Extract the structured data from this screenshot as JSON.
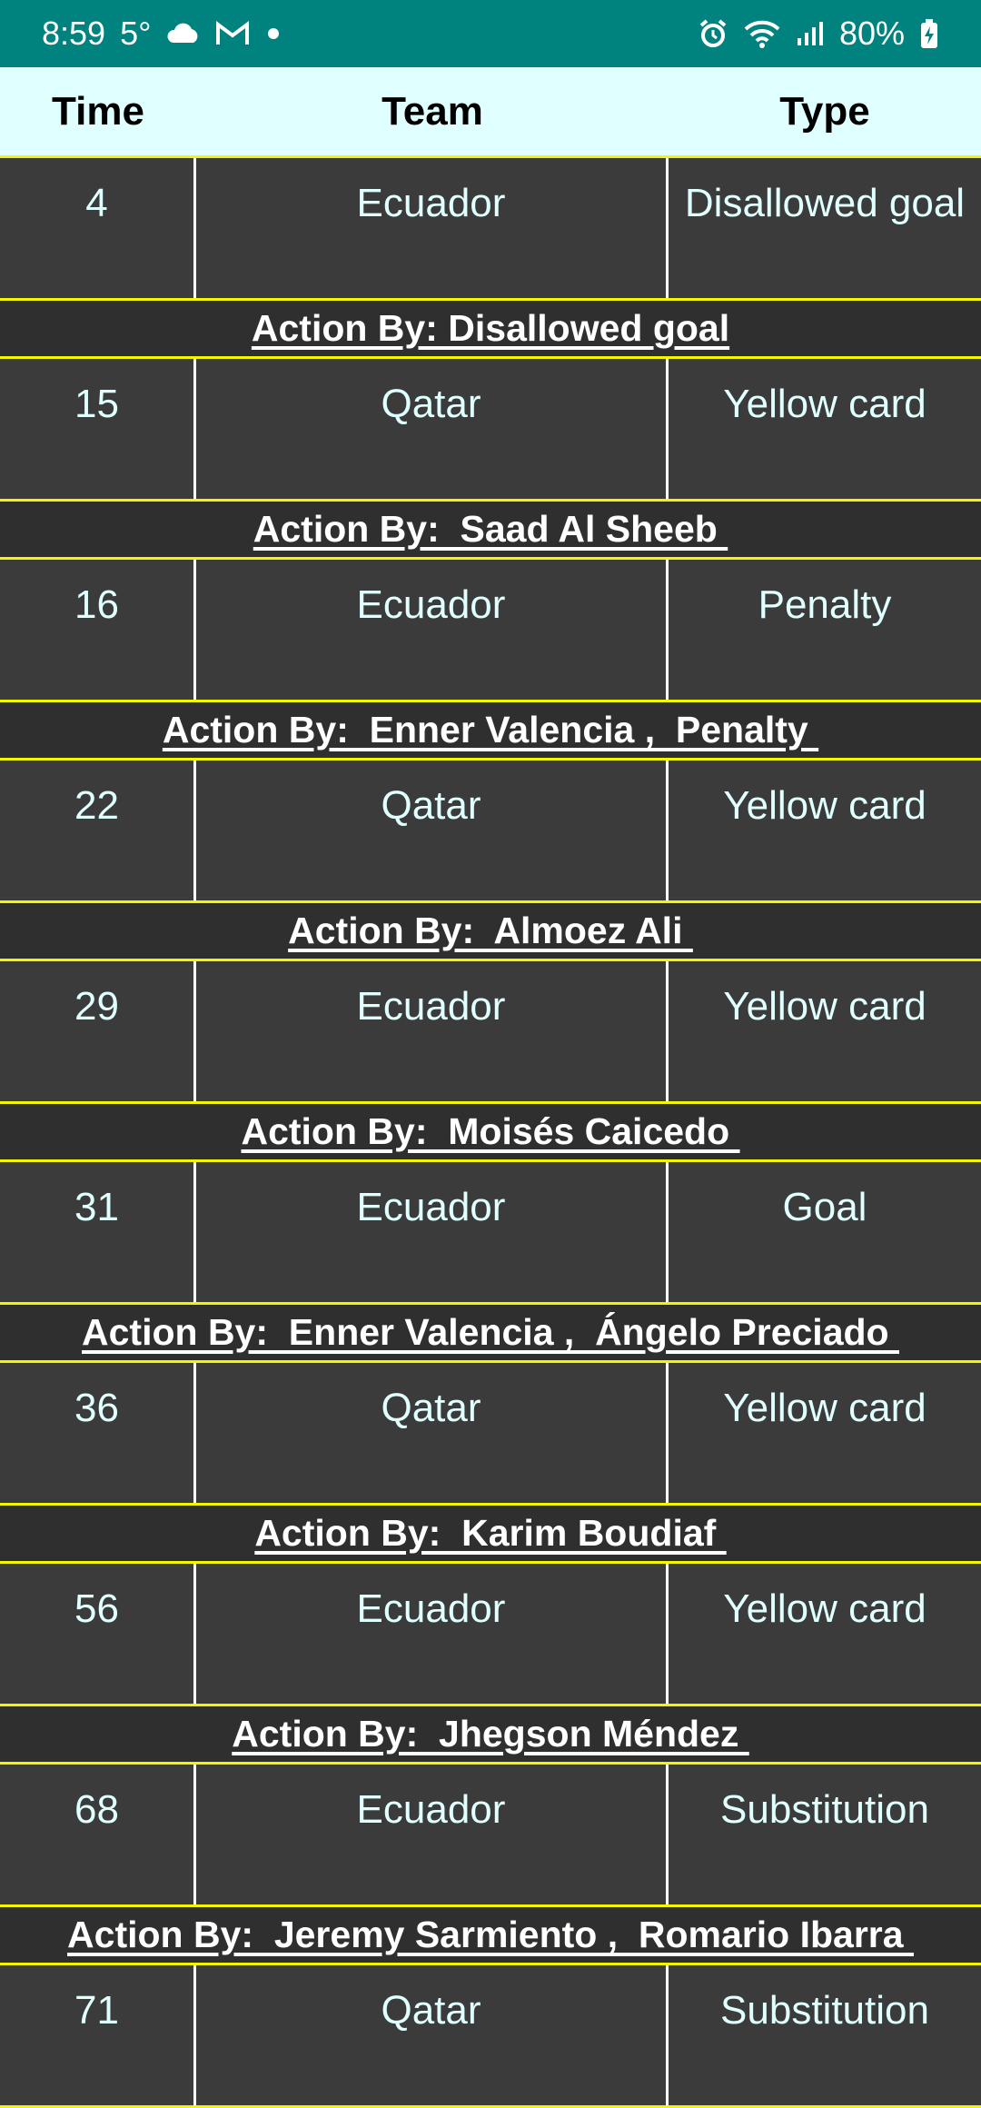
{
  "status_bar": {
    "time": "8:59",
    "temperature": "5°",
    "battery": "80%",
    "icons": [
      "cloud-icon",
      "gmail-icon",
      "dot-icon",
      "alarm-icon",
      "wifi-icon",
      "signal-icon",
      "battery-charging-icon"
    ]
  },
  "header": {
    "time_label": "Time",
    "team_label": "Team",
    "type_label": "Type"
  },
  "events": [
    {
      "time": "4",
      "team": "Ecuador",
      "type": "Disallowed goal",
      "action": "Action By: Disallowed goal"
    },
    {
      "time": "15",
      "team": "Qatar",
      "type": "Yellow card",
      "action": "Action By:  Saad Al Sheeb "
    },
    {
      "time": "16",
      "team": "Ecuador",
      "type": "Penalty",
      "action": "Action By:  Enner Valencia ,  Penalty "
    },
    {
      "time": "22",
      "team": "Qatar",
      "type": "Yellow card",
      "action": "Action By:  Almoez Ali "
    },
    {
      "time": "29",
      "team": "Ecuador",
      "type": "Yellow card",
      "action": "Action By:  Moisés Caicedo "
    },
    {
      "time": "31",
      "team": "Ecuador",
      "type": "Goal",
      "action": "Action By:  Enner Valencia ,  Ángelo Preciado "
    },
    {
      "time": "36",
      "team": "Qatar",
      "type": "Yellow card",
      "action": "Action By:  Karim Boudiaf "
    },
    {
      "time": "56",
      "team": "Ecuador",
      "type": "Yellow card",
      "action": "Action By:  Jhegson Méndez "
    },
    {
      "time": "68",
      "team": "Ecuador",
      "type": "Substitution",
      "action": "Action By:  Jeremy Sarmiento ,  Romario Ibarra "
    },
    {
      "time": "71",
      "team": "Qatar",
      "type": "Substitution",
      "action": ""
    }
  ]
}
